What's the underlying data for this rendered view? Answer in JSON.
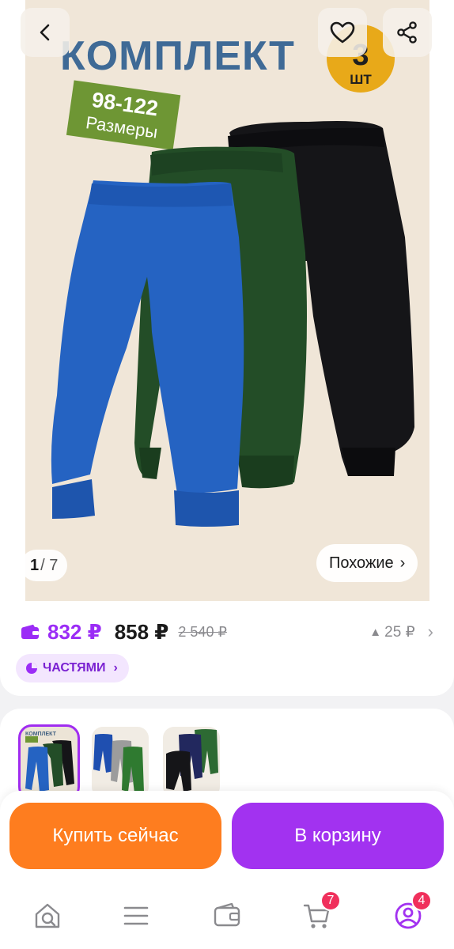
{
  "gallery": {
    "banner_title": "КОМПЛЕКТ",
    "quantity_number": "3",
    "quantity_unit": "ШТ",
    "size_range": "98-122",
    "size_label": "Размеры",
    "counter_current": "1",
    "counter_total": "/ 7",
    "similar_label": "Похожие",
    "similar_chevron": "›"
  },
  "price": {
    "wallet_price": "832 ₽",
    "main_price": "858 ₽",
    "old_price": "2 540 ₽",
    "price_change": "25 ₽",
    "price_change_arrow": "▲",
    "chevron": "›",
    "installments_label": "ЧАСТЯМИ",
    "installments_chevron": "›"
  },
  "thumbnails": {
    "first_thumb_title": "КОМПЛЕКТ",
    "selected_index": 1,
    "count_visible": 3
  },
  "actions": {
    "buy_now_label": "Купить сейчас",
    "add_to_cart_label": "В корзину"
  },
  "nav": {
    "cart_badge": "7",
    "profile_badge": "4",
    "items": [
      "home-search-icon",
      "catalog-menu-icon",
      "wallet-icon",
      "cart-icon",
      "profile-icon"
    ]
  },
  "colors": {
    "accent_purple": "#a232f0",
    "buy_orange": "#fe7d1f",
    "badge_red": "#f0305c",
    "wallet_price_purple": "#9b2cf6"
  }
}
